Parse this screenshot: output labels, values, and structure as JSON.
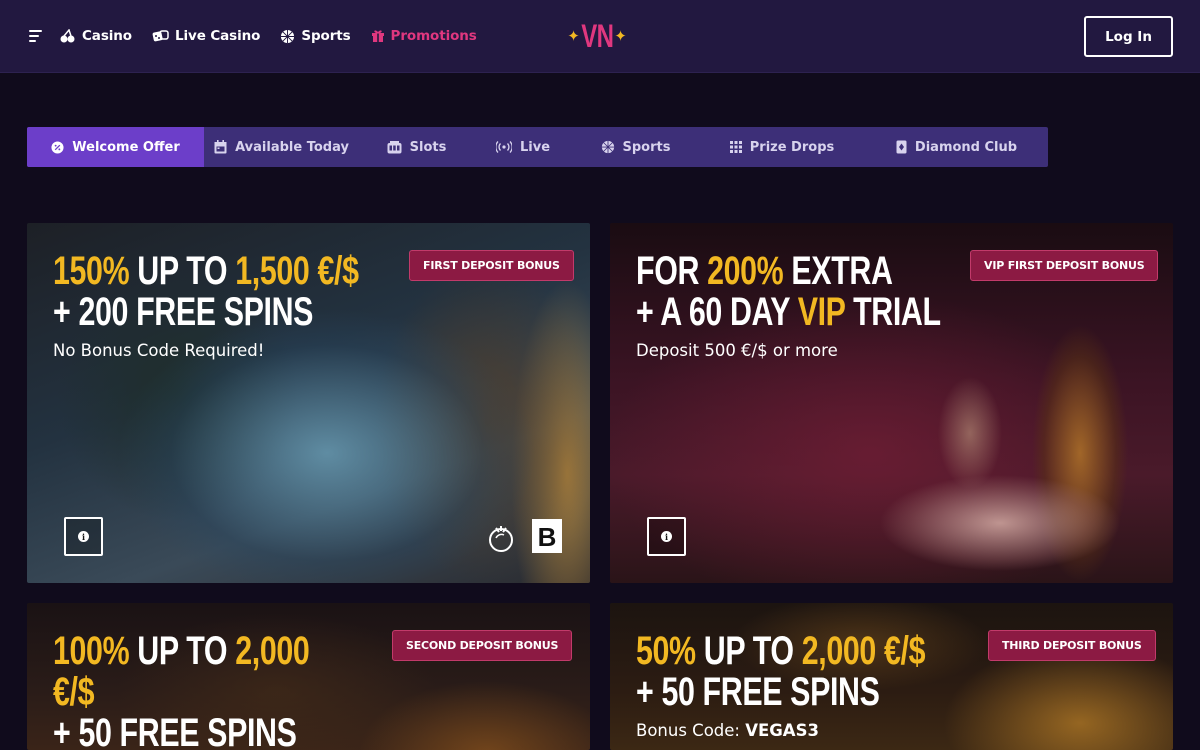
{
  "header": {
    "nav": [
      {
        "label": "Casino",
        "icon": "cherry-icon"
      },
      {
        "label": "Live Casino",
        "icon": "dice-icon"
      },
      {
        "label": "Sports",
        "icon": "ball-icon"
      },
      {
        "label": "Promotions",
        "icon": "gift-icon"
      }
    ],
    "logo": "VN",
    "login_label": "Log In"
  },
  "tabs": [
    {
      "label": "Welcome Offer",
      "icon": "badge-percent-icon"
    },
    {
      "label": "Available Today",
      "icon": "calendar-icon"
    },
    {
      "label": "Slots",
      "icon": "slot-machine-icon"
    },
    {
      "label": "Live",
      "icon": "broadcast-icon"
    },
    {
      "label": "Sports",
      "icon": "ball-icon"
    },
    {
      "label": "Prize Drops",
      "icon": "grid-icon"
    },
    {
      "label": "Diamond Club",
      "icon": "diamond-card-icon"
    }
  ],
  "cards": [
    {
      "badge": "FIRST DEPOSIT BONUS",
      "line1": [
        {
          "t": "150%",
          "gold": true
        },
        {
          "t": " UP TO ",
          "gold": false
        },
        {
          "t": "1,500 €/$",
          "gold": true
        }
      ],
      "line2": [
        {
          "t": "+ 200 FREE SPINS",
          "gold": false
        }
      ],
      "sub": "No Bonus Code Required!"
    },
    {
      "badge": "VIP FIRST DEPOSIT BONUS",
      "line1": [
        {
          "t": "FOR ",
          "gold": false
        },
        {
          "t": "200%",
          "gold": true
        },
        {
          "t": " EXTRA",
          "gold": false
        }
      ],
      "line2": [
        {
          "t": "+ A 60 DAY ",
          "gold": false
        },
        {
          "t": "VIP",
          "gold": true
        },
        {
          "t": " TRIAL",
          "gold": false
        }
      ],
      "sub": "Deposit 500 €/$ or more"
    },
    {
      "badge": "SECOND DEPOSIT BONUS",
      "line1": [
        {
          "t": "100%",
          "gold": true
        },
        {
          "t": " UP TO ",
          "gold": false
        },
        {
          "t": "2,000",
          "gold": true
        }
      ],
      "line2": [
        {
          "t": "€/$",
          "gold": true
        }
      ],
      "line3": [
        {
          "t": "+ 50 FREE SPINS",
          "gold": false
        }
      ]
    },
    {
      "badge": "THIRD DEPOSIT BONUS",
      "line1": [
        {
          "t": "50%",
          "gold": true
        },
        {
          "t": " UP TO ",
          "gold": false
        },
        {
          "t": "2,000 €/$",
          "gold": true
        }
      ],
      "line2": [
        {
          "t": "+ 50 FREE SPINS",
          "gold": false
        }
      ],
      "sub_prefix": "Bonus Code: ",
      "sub_code": "VEGAS3"
    }
  ],
  "colors": {
    "accent": "#6c3ec9",
    "pink": "#e0377f",
    "gold": "#f2b822",
    "badge": "#8c1a43"
  }
}
